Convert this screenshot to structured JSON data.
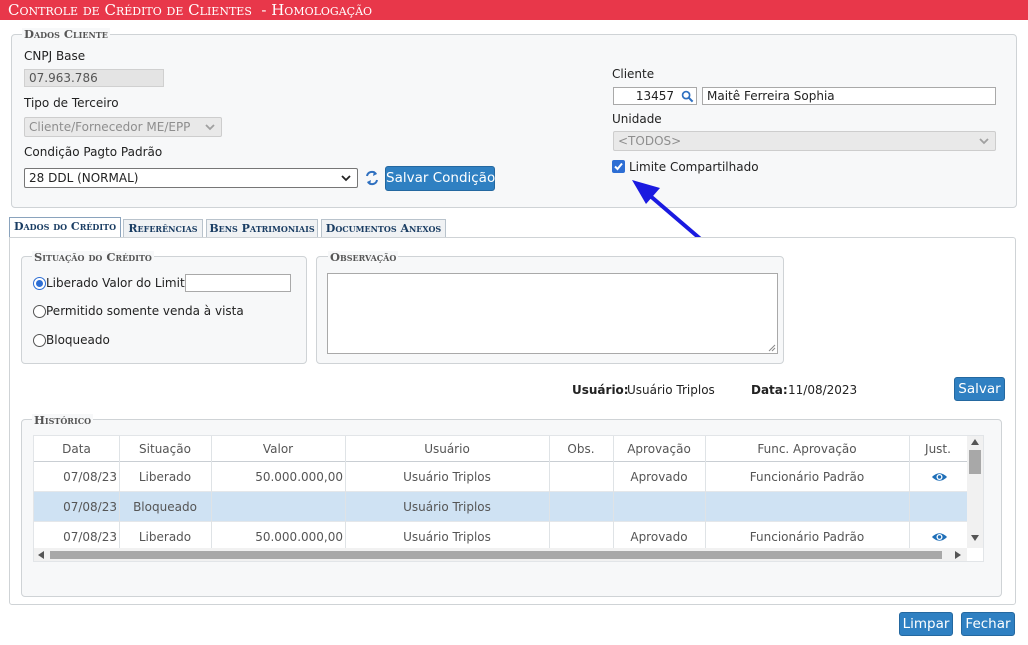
{
  "window": {
    "title": "Controle de Crédito de Clientes  - Homologação"
  },
  "dados_cliente": {
    "legend": "Dados Cliente",
    "cnpj_label": "CNPJ Base",
    "cnpj_value": "07.963.786",
    "tipo_label": "Tipo de Terceiro",
    "tipo_value": "Cliente/Fornecedor ME/EPP",
    "condicao_label": "Condição Pagto Padrão",
    "condicao_value": "28 DDL (NORMAL)",
    "salvar_condicao": "Salvar Condição",
    "cliente_label": "Cliente",
    "cliente_code": "13457",
    "cliente_name": "Maitê Ferreira Sophia",
    "unidade_label": "Unidade",
    "unidade_value": "<TODOS>",
    "limite_label": "Limite Compartilhado",
    "limite_checked": true
  },
  "tabs": [
    {
      "label": "Dados do Crédito",
      "active": true
    },
    {
      "label": "Referências",
      "active": false
    },
    {
      "label": "Bens Patrimoniais",
      "active": false
    },
    {
      "label": "Documentos Anexos",
      "active": false
    }
  ],
  "situacao": {
    "legend": "Situação do Crédito",
    "options": [
      {
        "label": "Liberado Valor do Limite:",
        "selected": true
      },
      {
        "label": "Permitido somente venda à vista",
        "selected": false
      },
      {
        "label": "Bloqueado",
        "selected": false
      }
    ],
    "limite_value": ""
  },
  "observacao": {
    "legend": "Observação",
    "value": ""
  },
  "meta": {
    "usuario_label": "Usuário:",
    "usuario_value": "Usuário Triplos",
    "data_label": "Data:",
    "data_value": "11/08/2023",
    "salvar": "Salvar"
  },
  "historico": {
    "legend": "Histórico",
    "columns": [
      "Data",
      "Situação",
      "Valor",
      "Usuário",
      "Obs.",
      "Aprovação",
      "Func. Aprovação",
      "Just."
    ],
    "rows": [
      {
        "data": "07/08/23",
        "situacao": "Liberado",
        "valor": "50.000.000,00",
        "usuario": "Usuário Triplos",
        "obs": "",
        "aprovacao": "Aprovado",
        "func": "Funcionário Padrão",
        "just_icon": "eye-icon",
        "selected": false
      },
      {
        "data": "07/08/23",
        "situacao": "Bloqueado",
        "valor": "",
        "usuario": "Usuário Triplos",
        "obs": "",
        "aprovacao": "",
        "func": "",
        "just_icon": "",
        "selected": true
      },
      {
        "data": "07/08/23",
        "situacao": "Liberado",
        "valor": "50.000.000,00",
        "usuario": "Usuário Triplos",
        "obs": "",
        "aprovacao": "Aprovado",
        "func": "Funcionário Padrão",
        "just_icon": "eye-icon",
        "selected": false
      }
    ]
  },
  "footer": {
    "limpar": "Limpar",
    "fechar": "Fechar"
  },
  "colors": {
    "title_bar": "#e8374a",
    "button": "#2f80c2",
    "selected_row": "#cfe2f3",
    "annotation_arrow": "#1a1ae0"
  }
}
